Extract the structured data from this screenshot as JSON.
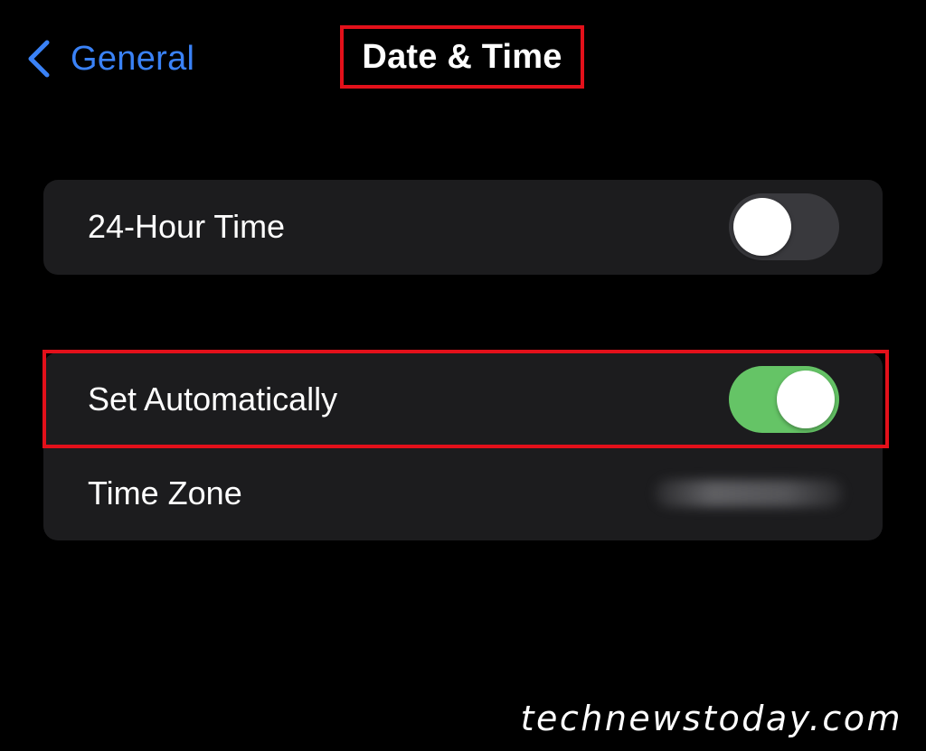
{
  "nav": {
    "back_label": "General",
    "title": "Date & Time"
  },
  "settings": {
    "hour24": {
      "label": "24-Hour Time",
      "enabled": false
    },
    "set_automatically": {
      "label": "Set Automatically",
      "enabled": true
    },
    "time_zone": {
      "label": "Time Zone"
    }
  },
  "colors": {
    "accent_blue": "#3a82f7",
    "toggle_on": "#65c466",
    "toggle_off": "#39393d",
    "cell_background": "#1c1c1e",
    "highlight_red": "#e3101a"
  },
  "icons": {
    "back": "chevron-left-icon"
  },
  "watermark": "technewstoday.com"
}
